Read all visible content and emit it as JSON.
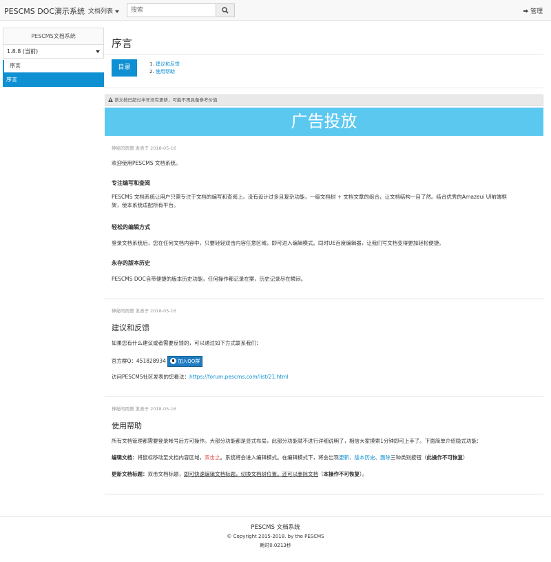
{
  "topbar": {
    "brand": "PESCMS DOC演示系统",
    "doc_menu_label": "文档列表",
    "search_placeholder": "搜索",
    "admin_label": "管理"
  },
  "sidebar": {
    "title": "PESCMS文档系统",
    "version": "1.8.8 (当前)",
    "items": [
      {
        "label": "序言"
      },
      {
        "label": "序言"
      }
    ]
  },
  "main": {
    "title": "序言",
    "toc_button": "目录",
    "toc_items": [
      "1. ",
      "建议和反馈",
      "2. ",
      "使用帮助"
    ],
    "warning": "该文档已超过半年没有更新，可能不再具备参考价值",
    "ad_text": "广告投放",
    "sections": [
      {
        "meta": "神秘的雨僧 发表于 2018-05-16",
        "intro": "欢迎使用PESCMS 文档系统。",
        "h1": "专注编写和查阅",
        "p1a": "PESCMS 文档系统让用户只需专注于文档的编写和查阅上。没有设计过多且复杂功能，一级文档树 + 文档文章的组合，让文档结构一目了然。结合优秀的Amazeui UI前端框",
        "p1b": "架，使本系统适配所有平台。",
        "h2": "轻松的编辑方式",
        "p2": "登录文档系统后，您在任何文档内容中，只要轻轻双击内容任意区域，即可进入编辑模式。同时UE百度编辑器，让我们写文档变得更加轻松便捷。",
        "h3": "永存的版本历史",
        "p3": "PESCMS DOC自带便捷的版本历史功能，任何操作都记录在案，历史记录尽在瞬间。"
      },
      {
        "meta": "神秘的雨僧 发表于 2018-05-16",
        "title": "建议和反馈",
        "p1": "如果您有什么建议或者需要反馈的，可以通过如下方式联系我们：",
        "qq_label": "官方群Q：451828934",
        "qq_button": "加入QQ群",
        "visit_text": "访问PESCMS社区发表的您看法：",
        "visit_link": "https://forum.pescms.com/list/21.html"
      },
      {
        "meta": "神秘的雨僧 发表于 2018-05-16",
        "title": "使用帮助",
        "p1": "所有文档管理都需要登录帐号后方可操作。大部分功能都是显式布局，此部分功能就不进行详细说明了，相信大家摸索1分钟即可上手了。下面简单介绍隐式功能：",
        "edit_label": "编辑文档：",
        "edit_a": "将鼠标移动至文档内容区域，",
        "edit_red": "双击之",
        "edit_b": "。系统将会进入编辑模式。在编辑模式下，将会出现",
        "edit_link1": "更新",
        "edit_sep1": "、",
        "edit_link2": "版本历史",
        "edit_sep2": "、",
        "edit_link3": "删除",
        "edit_c": "三种类别按钮（",
        "edit_bold": "此操作不可恢复",
        "edit_d": "）",
        "title_label": "更新文档标题：",
        "title_a": "双击文档标题，",
        "title_u": "即可快速编辑文档标题，切换文档树位置。还可以删除文档",
        "title_b": "（",
        "title_bold": "本操作不可恢复",
        "title_c": "）。"
      }
    ]
  },
  "footer": {
    "name": "PESCMS 文档系统",
    "copyright": "© Copyright 2015-2018. by the PESCMS",
    "timing": "耗时0.0213秒"
  }
}
